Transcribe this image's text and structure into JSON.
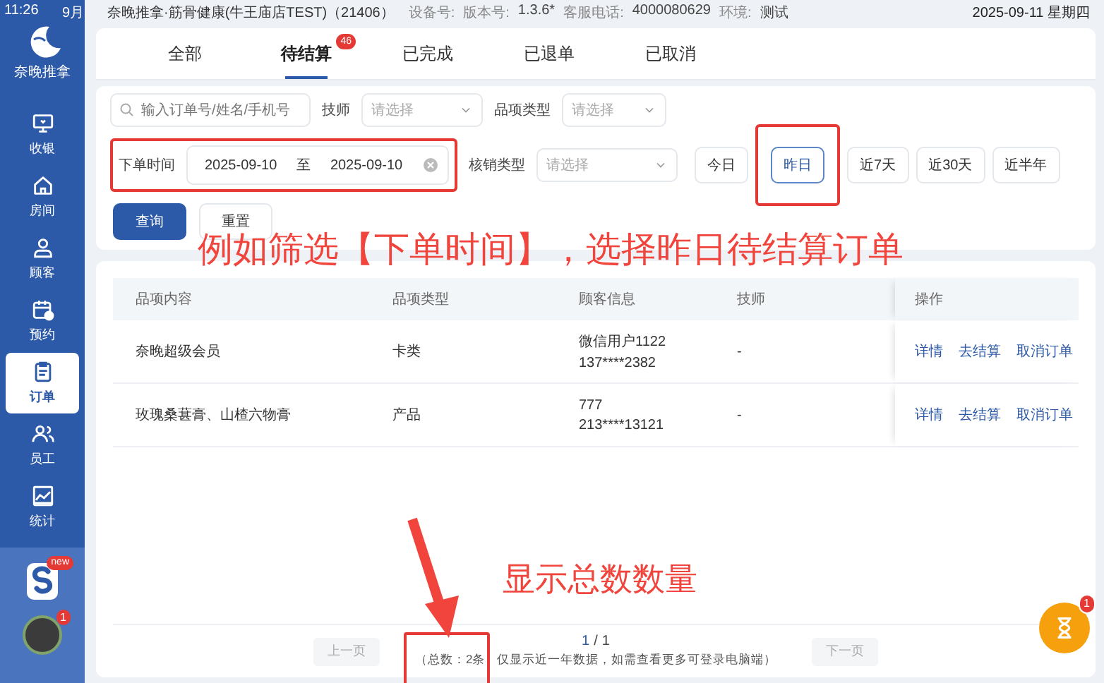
{
  "status_bar": {
    "time": "11:26",
    "date": "9月"
  },
  "header": {
    "title": "奈晚推拿·筋骨健康(牛王庙店TEST)（21406）",
    "info": [
      "设备号:",
      "版本号:",
      "1.3.6*",
      "客服电话:",
      "4000080629",
      "环境:",
      "测试"
    ],
    "datetime": "2025-09-11 星期四"
  },
  "sidebar": {
    "logo": "奈晚推拿",
    "items": [
      {
        "label": "收银",
        "selected": false
      },
      {
        "label": "房间",
        "selected": false
      },
      {
        "label": "顾客",
        "selected": false
      },
      {
        "label": "预约",
        "selected": false
      },
      {
        "label": "订单",
        "selected": true
      },
      {
        "label": "员工",
        "selected": false
      },
      {
        "label": "统计",
        "selected": false
      }
    ],
    "app_badge": "new",
    "avatar_badge": "1"
  },
  "tabs": [
    {
      "label": "全部",
      "selected": false
    },
    {
      "label": "待结算",
      "selected": true,
      "badge": "46"
    },
    {
      "label": "已完成",
      "selected": false
    },
    {
      "label": "已退单",
      "selected": false
    },
    {
      "label": "已取消",
      "selected": false
    }
  ],
  "filters": {
    "search": {
      "placeholder": "输入订单号/姓名/手机号"
    },
    "technician": {
      "label": "技师",
      "placeholder": "请选择"
    },
    "item_type": {
      "label": "品项类型",
      "placeholder": "请选择"
    },
    "order_time": {
      "label": "下单时间",
      "start": "2025-09-10",
      "separator": "至",
      "end": "2025-09-10",
      "highlighted": true
    },
    "writeoff_type": {
      "label": "核销类型",
      "placeholder": "请选择"
    },
    "quick_dates": [
      {
        "label": "今日",
        "selected": false,
        "highlighted": false
      },
      {
        "label": "昨日",
        "selected": true,
        "highlighted": true
      },
      {
        "label": "近7天",
        "selected": false,
        "highlighted": false
      },
      {
        "label": "近30天",
        "selected": false,
        "highlighted": false
      },
      {
        "label": "近半年",
        "selected": false,
        "highlighted": false
      }
    ],
    "buttons": [
      {
        "label": "查询",
        "kind": "primary"
      },
      {
        "label": "重置",
        "kind": "default"
      }
    ]
  },
  "table": {
    "columns": [
      "品项内容",
      "品项类型",
      "顾客信息",
      "技师",
      "操作"
    ],
    "rows": [
      {
        "item": "奈晚超级会员",
        "type": "卡类",
        "customer": [
          "微信用户1122",
          "137****2382"
        ],
        "technician": "-",
        "actions": [
          "详情",
          "去结算",
          "取消订单"
        ]
      },
      {
        "item": "玫瑰桑葚膏、山楂六物膏",
        "type": "产品",
        "customer": [
          "777",
          "213****13121"
        ],
        "technician": "-",
        "actions": [
          "详情",
          "去结算",
          "取消订单"
        ]
      }
    ]
  },
  "pagination": {
    "prev": "上一页",
    "current": "1",
    "total": "1",
    "separator": "/",
    "note": "（总数：2条 仅显示近一年数据，如需查看更多可登录电脑端）",
    "next": "下一页",
    "note_highlighted": true
  },
  "timer_badge": "1",
  "annotations": [
    {
      "text": "例如筛选【下单时间】，选择昨日待结算订单",
      "kind": "caption"
    },
    {
      "text": "显示总数数量",
      "kind": "arrow-caption"
    }
  ]
}
